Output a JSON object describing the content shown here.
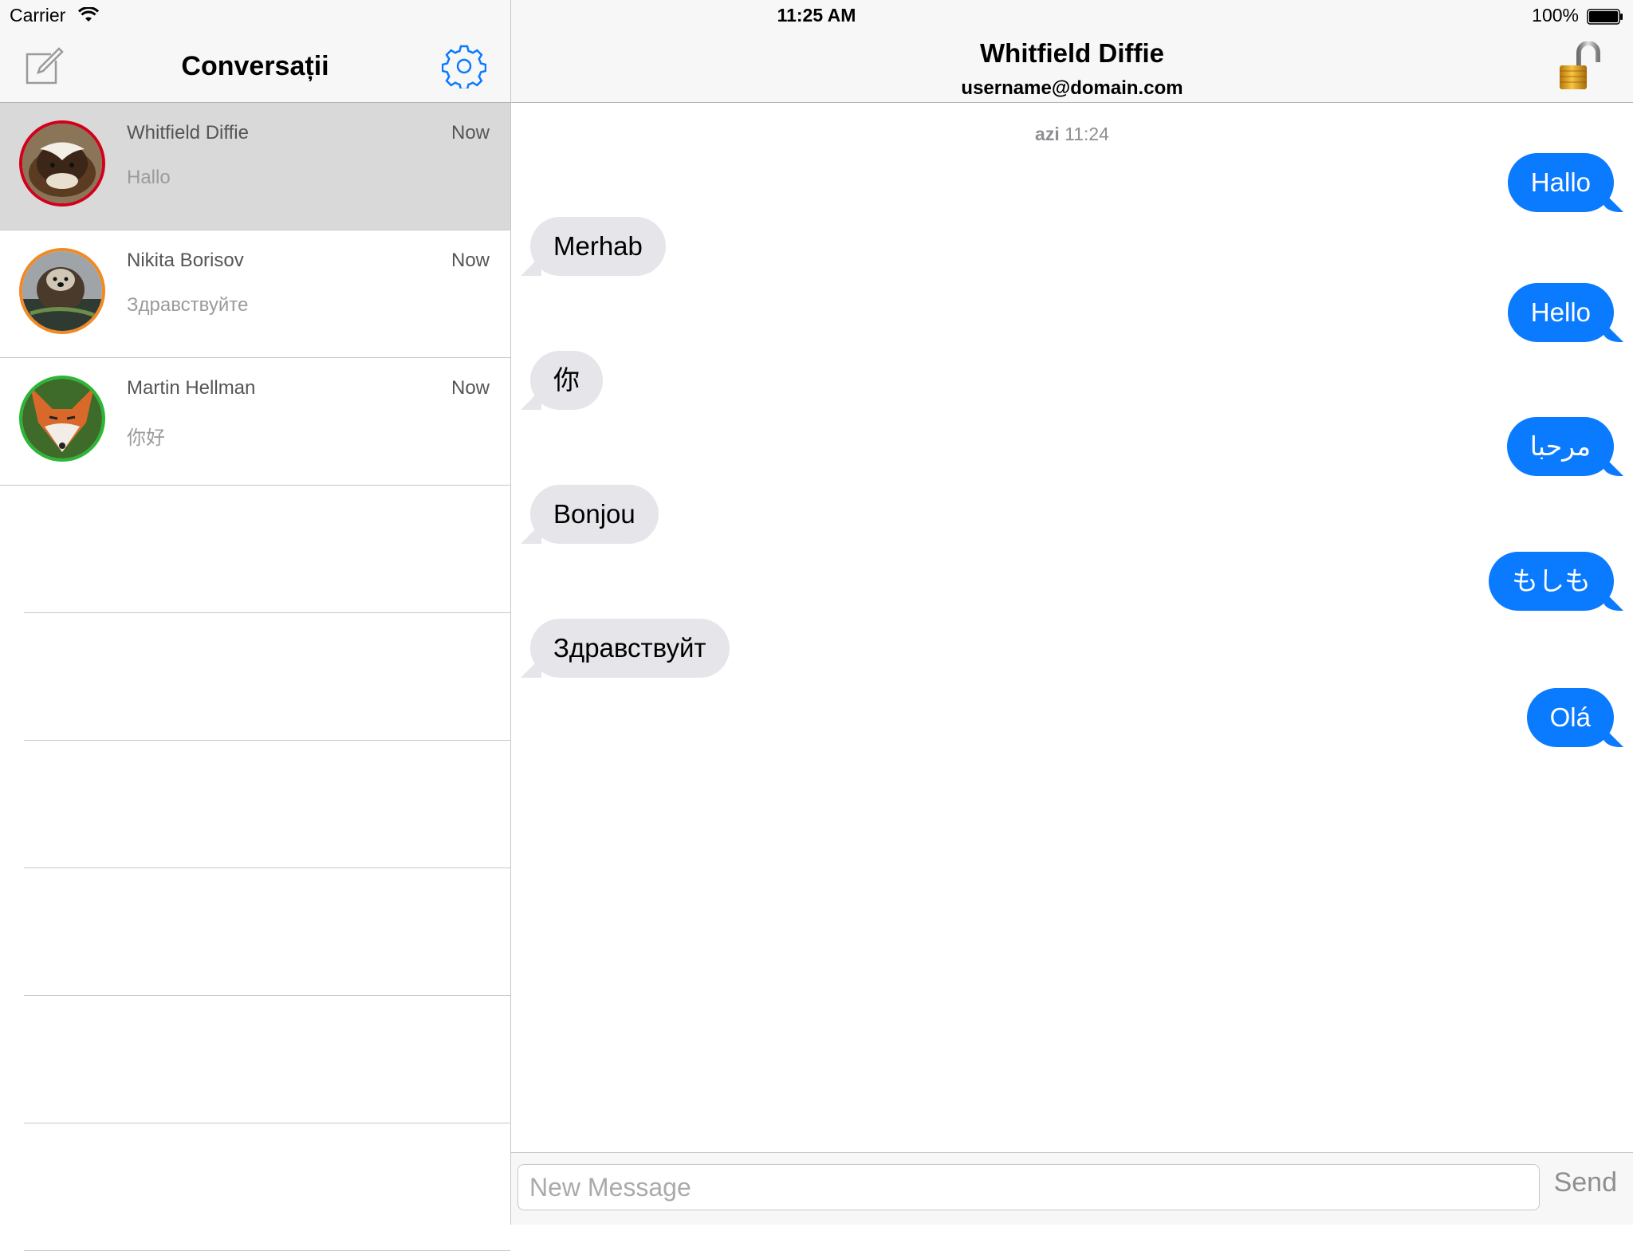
{
  "status_bar": {
    "carrier": "Carrier",
    "time": "11:25 AM",
    "battery": "100%"
  },
  "left_header": {
    "title": "Conversații"
  },
  "conversations": [
    {
      "name": "Whitfield Diffie",
      "time": "Now",
      "preview": "Hallo",
      "ring_color": "#d0021b",
      "selected": true,
      "avatar": "badger"
    },
    {
      "name": "Nikita Borisov",
      "time": "Now",
      "preview": "Здравствуйте",
      "ring_color": "#f08a24",
      "selected": false,
      "avatar": "otter"
    },
    {
      "name": "Martin Hellman",
      "time": "Now",
      "preview": "你好",
      "ring_color": "#2bb735",
      "selected": false,
      "avatar": "fox"
    }
  ],
  "chat_header": {
    "name": "Whitfield Diffie",
    "email": "username@domain.com"
  },
  "thread": {
    "date_day": "azi",
    "date_time": "11:24",
    "messages": [
      {
        "dir": "out",
        "text": "Hallo"
      },
      {
        "dir": "in",
        "text": "Merhab"
      },
      {
        "dir": "out",
        "text": "Hello"
      },
      {
        "dir": "in",
        "text": "你"
      },
      {
        "dir": "out",
        "text": "مرحبا"
      },
      {
        "dir": "in",
        "text": "Bonjou"
      },
      {
        "dir": "out",
        "text": "もしも"
      },
      {
        "dir": "in",
        "text": "Здравствуйт"
      },
      {
        "dir": "out",
        "text": "Olá"
      }
    ]
  },
  "composer": {
    "placeholder": "New Message",
    "send_label": "Send"
  },
  "colors": {
    "accent": "#0a7aff",
    "incoming_bubble": "#e5e5ea",
    "selected_row": "#d9d9d9"
  }
}
